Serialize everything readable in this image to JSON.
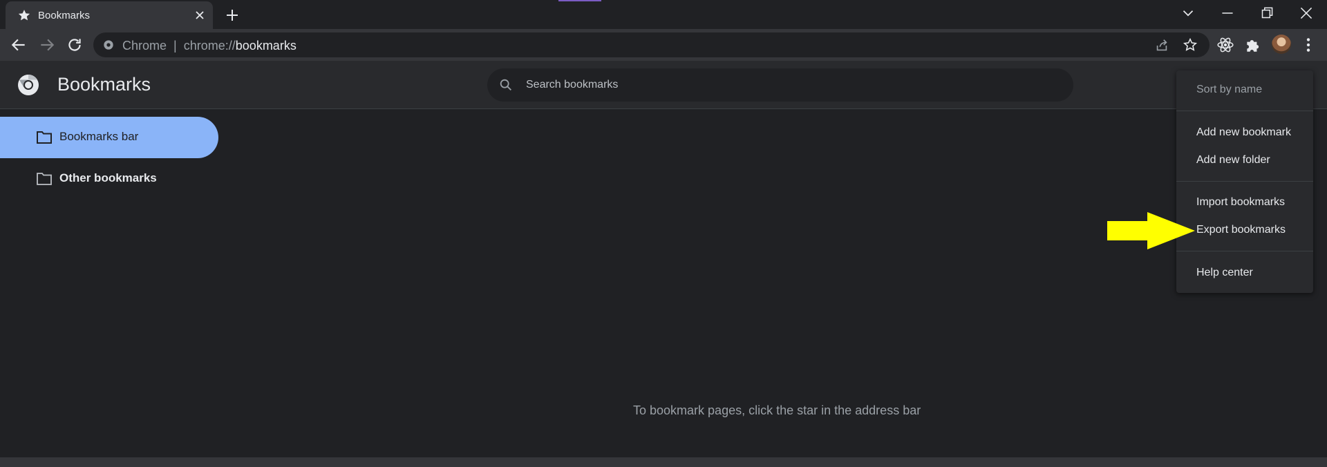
{
  "browser": {
    "tab_title": "Bookmarks",
    "address_scheme_label": "Chrome",
    "address_separator": "|",
    "address_prefix": "chrome://",
    "address_host": "bookmarks"
  },
  "header": {
    "title": "Bookmarks",
    "search_placeholder": "Search bookmarks"
  },
  "sidebar": {
    "items": [
      {
        "label": "Bookmarks bar",
        "selected": true
      },
      {
        "label": "Other bookmarks",
        "selected": false
      }
    ]
  },
  "main": {
    "empty_message": "To bookmark pages, click the star in the address bar"
  },
  "menu": {
    "items": [
      {
        "label": "Sort by name",
        "enabled": false
      },
      {
        "label": "Add new bookmark",
        "enabled": true
      },
      {
        "label": "Add new folder",
        "enabled": true
      },
      {
        "label": "Import bookmarks",
        "enabled": true
      },
      {
        "label": "Export bookmarks",
        "enabled": true
      },
      {
        "label": "Help center",
        "enabled": true
      }
    ]
  },
  "annotation": {
    "arrow_color": "#ffff00",
    "points_to": "Export bookmarks"
  },
  "colors": {
    "accent": "#8ab4f8",
    "background": "#202124",
    "surface": "#292a2d",
    "toolbar": "#35363a"
  }
}
